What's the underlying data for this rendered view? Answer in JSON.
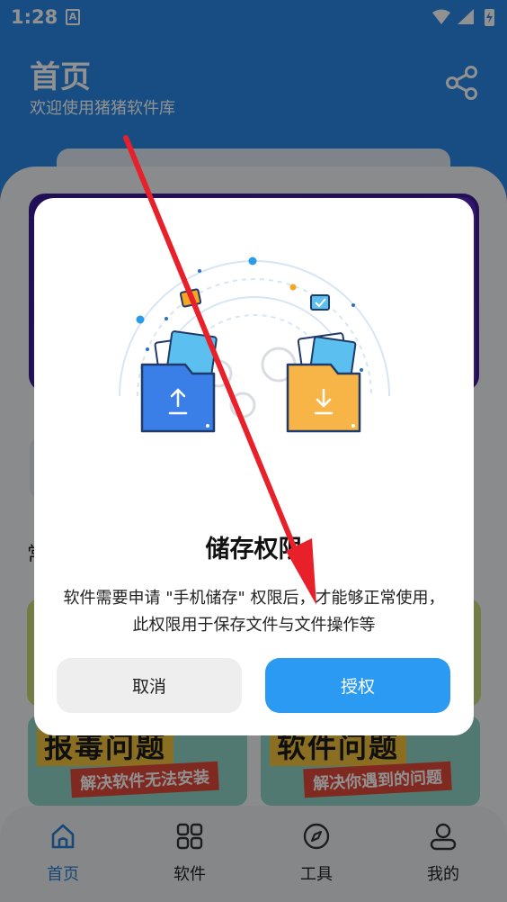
{
  "status_bar": {
    "time": "1:28",
    "notification_glyph": "A",
    "icons": [
      "wifi-icon",
      "signal-icon",
      "battery-charging-icon"
    ]
  },
  "header": {
    "title": "首页",
    "subtitle": "欢迎使用猪猪软件库",
    "share_icon": "share-icon"
  },
  "background_content": {
    "section_glyph": "常",
    "promo_cards": [
      {
        "title": "报毒问题",
        "subtitle": "解决软件无法安装"
      },
      {
        "title": "软件问题",
        "subtitle": "解决你遇到的问题"
      }
    ]
  },
  "bottom_nav": {
    "items": [
      {
        "label": "首页",
        "icon": "home-icon",
        "active": true
      },
      {
        "label": "软件",
        "icon": "grid-icon",
        "active": false
      },
      {
        "label": "工具",
        "icon": "compass-icon",
        "active": false
      },
      {
        "label": "我的",
        "icon": "profile-icon",
        "active": false
      }
    ]
  },
  "dialog": {
    "title": "储存权限",
    "message_line1": "软件需要申请 \"手机储存\" 权限后，才能够正常使用，",
    "message_line2": "此权限用于保存文件与文件操作等",
    "cancel_label": "取消",
    "confirm_label": "授权",
    "illustration": "folder-transfer-illustration"
  },
  "colors": {
    "primary": "#2a88e6",
    "confirm_button": "#2b9af3",
    "annotation_arrow": "#e8202a"
  }
}
